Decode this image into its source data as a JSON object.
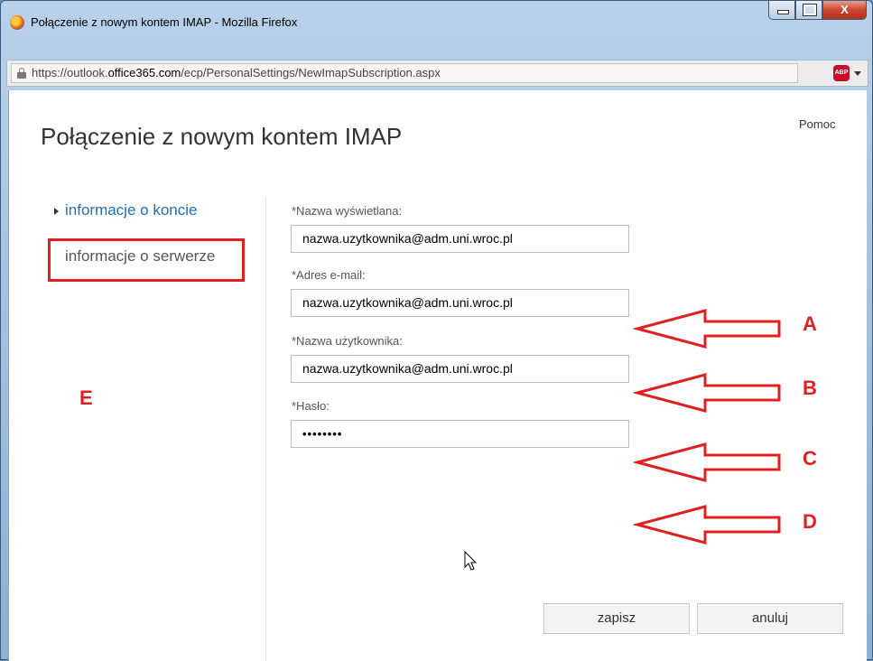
{
  "window": {
    "title": "Połączenie z nowym kontem IMAP - Mozilla Firefox",
    "minimize_label": "",
    "close_label": "X"
  },
  "browser": {
    "url_prefix": "https://outlook.",
    "url_host": "office365.com",
    "url_path": "/ecp/PersonalSettings/NewImapSubscription.aspx",
    "adblock_label": "ABP"
  },
  "page": {
    "title": "Połączenie z nowym kontem IMAP",
    "help_link": "Pomoc"
  },
  "nav": {
    "items": [
      {
        "label": "informacje o koncie",
        "active": true
      },
      {
        "label": "informacje o serwerze",
        "active": false
      }
    ]
  },
  "form": {
    "display_name": {
      "label": "*Nazwa wyświetlana:",
      "value": "nazwa.uzytkownika@adm.uni.wroc.pl"
    },
    "email": {
      "label": "*Adres e-mail:",
      "value": "nazwa.uzytkownika@adm.uni.wroc.pl"
    },
    "username": {
      "label": "*Nazwa użytkownika:",
      "value": "nazwa.uzytkownika@adm.uni.wroc.pl"
    },
    "password": {
      "label": "*Hasło:",
      "value": "••••••••"
    }
  },
  "buttons": {
    "save": "zapisz",
    "cancel": "anuluj"
  },
  "annotations": {
    "letters": [
      "A",
      "B",
      "C",
      "D",
      "E"
    ],
    "color": "#e02020"
  },
  "colors": {
    "link": "#1d6fb8",
    "titlebar": "#b9d1ea"
  }
}
